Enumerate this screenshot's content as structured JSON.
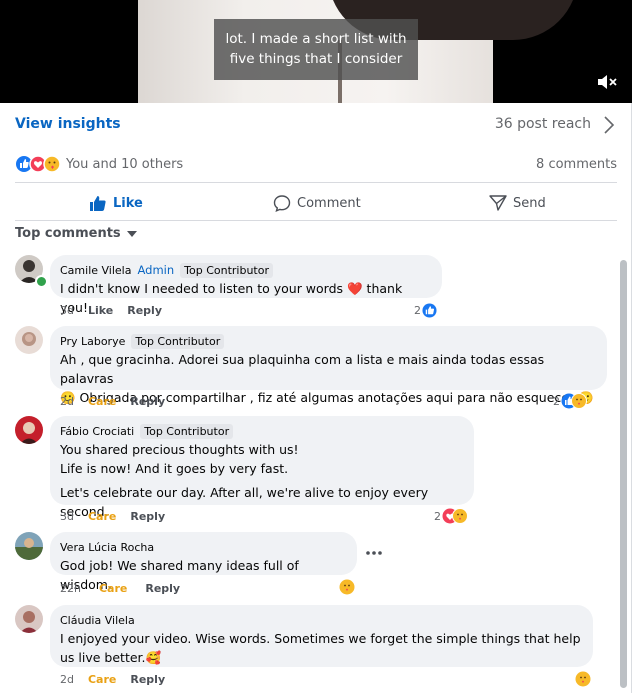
{
  "video": {
    "caption_line1": "lot. I made a short list with",
    "caption_line2": "five things that I consider"
  },
  "insights": {
    "view_label": "View insights",
    "post_reach": "36 post reach"
  },
  "summary": {
    "reactions_text": "You and 10 others",
    "comments_count": "8 comments"
  },
  "actions": {
    "like": "Like",
    "comment": "Comment",
    "send": "Send"
  },
  "top_comments_label": "Top comments",
  "comments": [
    {
      "author": "Camile Vilela",
      "admin": "Admin",
      "badge": "Top Contributor",
      "text": "I didn't know I needed to listen to your words ❤️ thank you!",
      "time": "3d",
      "reaction_label": "Like",
      "reply": "Reply",
      "count": "2"
    },
    {
      "author": "Pry Laborye",
      "badge": "Top Contributor",
      "line1": "Ah , que gracinha. Adorei sua plaquinha com a lista e mais ainda todas essas palavras",
      "line2": "🙂 Obrigada por compartilhar , fiz até algumas anotações aqui para não esquecer 🙂",
      "time": "2d",
      "reaction_label": "Care",
      "reply": "Reply",
      "count": "2"
    },
    {
      "author": "Fábio Crociati",
      "badge": "Top Contributor",
      "line1": "You shared precious thoughts with us!",
      "line2": "Life is now! And it goes by very fast.",
      "line3": "Let's celebrate our day. After all, we're alive to enjoy every second.",
      "time": "3d",
      "reaction_label": "Care",
      "reply": "Reply",
      "count": "2"
    },
    {
      "author": "Vera Lúcia Rocha",
      "text": "God job! We shared many ideas full of wisdom.",
      "time": "22h",
      "reaction_label": "Care",
      "reply": "Reply"
    },
    {
      "author": "Cláudia Vilela",
      "line1": "I enjoyed your video. Wise words. Sometimes we forget the simple things that help",
      "line2": "us live better.🥰",
      "time": "2d",
      "reaction_label": "Care",
      "reply": "Reply"
    }
  ],
  "colors": {
    "accent": "#0a66c2",
    "care": "#e9a114",
    "bubble": "#f0f2f5"
  }
}
